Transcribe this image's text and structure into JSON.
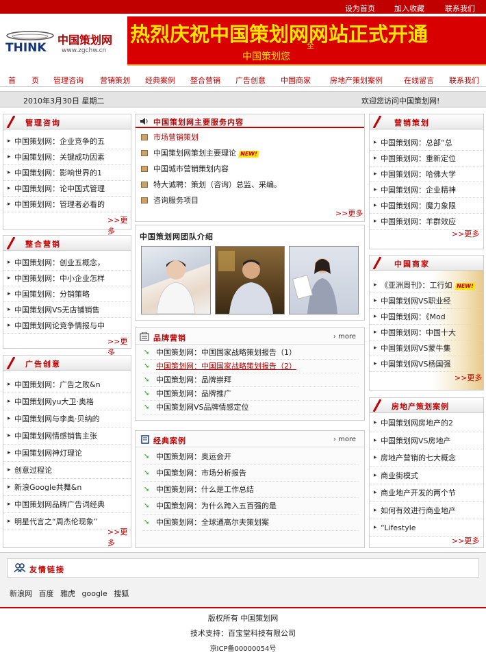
{
  "topbar": {
    "home": "设为首页",
    "fav": "加入收藏",
    "contact": "联系我们"
  },
  "logo": {
    "brand": "THINK",
    "name": "中国策划网",
    "url": "www.zgchw.cn"
  },
  "banner": {
    "title": "热烈庆祝中国策划网网站正式开通",
    "subtitle": "中国策划您",
    "star": "全"
  },
  "nav": [
    "首",
    "页",
    "管理咨询",
    "营销策划",
    "经典案例",
    "整合营销",
    "广告创意",
    "中国商家",
    "房地产策划案例",
    "在线留言",
    "联系我们"
  ],
  "datebar": {
    "date": "2010年3月30日 星期二",
    "welcome": "欢迎您访问中国策划网!"
  },
  "left": {
    "guanli": {
      "title": "管理咨询",
      "items": [
        "中国策划网：企业竞争的五",
        "中国策划网：关键成功因素",
        "中国策划网：影响世界的1",
        "中国策划网：论中国式管理",
        "中国策划网：管理者必看的"
      ],
      "more": ">>更多"
    },
    "zhenghe": {
      "title": "整合营销",
      "items": [
        "中国策划网：创业五概念，",
        "中国策划网：中小企业怎样",
        "中国策划网：分销策略",
        "中国策划网VS无店铺销售",
        "中国策划网论竞争情报与中"
      ],
      "more": ">>更多"
    },
    "guanggao": {
      "title": "广告创意",
      "items": [
        "中国策划网：广告之败&n",
        "中国策划网yu大卫·奥格",
        "中国策划网与李奥·贝纳的",
        "中国策划网情感销售主张",
        "中国策划网神灯理论",
        "创意过程论",
        "新浪Google共舞&n",
        "中国策划网品牌广告词经典",
        "明星代言之“周杰伦现象”"
      ],
      "more": ">>更多"
    }
  },
  "center": {
    "services": {
      "title": "中国策划网主要服务内容",
      "items": [
        "市场营销策划",
        "中国策划网策划主要理论",
        "中国城市营销策划内容",
        "特大诚聘：策划（咨询）总监、采编。",
        "咨询服务项目"
      ],
      "new": "NEW!",
      "more": ">>更多"
    },
    "team": {
      "title": "中国策划网团队介绍"
    },
    "brand": {
      "title": "品牌营销",
      "more": "more",
      "items": [
        "中国策划网：中国国家战略策划报告（1）",
        "中国策划网：中国国家战略策划报告（2）",
        "中国策划网：品牌崇拜",
        "中国策划网：品牌推广",
        "中国策划网VS品牌情感定位"
      ]
    },
    "classic": {
      "title": "经典案例",
      "more": "more",
      "items": [
        "中国策划网：奥运会开",
        "中国策划网：市场分析报告",
        "中国策划网：什么是工作总结",
        "中国策划网：为什么跨入五百强的是",
        "中国策划网：全球通高尔夫策划案"
      ]
    }
  },
  "right": {
    "yingxiao": {
      "title": "营销策划",
      "items": [
        "中国策划网：总部“总",
        "中国策划网：重新定位",
        "中国策划网：哈佛大学",
        "中国策划网：企业精神",
        "中国策划网：魔力象限",
        "中国策划网：羊群效应"
      ],
      "more": ">>更多"
    },
    "shangjia": {
      "title": "中国商家",
      "items": [
        "《亚洲周刊》：工行如",
        "中国策划网VS职业经",
        "中国策划网：《Mod",
        "中国策划网：中国十大",
        "中国策划网VS蒙牛集",
        "中国策划网VS杨国强"
      ],
      "new": "NEW!",
      "more": ">>更多"
    },
    "fangdichan": {
      "title": "房地产策划案例",
      "items": [
        "中国策划网房地产的2",
        "中国策划网VS房地产",
        "房地产营销的七大概念",
        "商业街模式",
        "商业地产开发的两个节",
        "如何有效进行商业地产",
        "“Lifestyle"
      ],
      "more": ">>更多"
    }
  },
  "friend": {
    "title": "友情链接",
    "links": [
      "新浪网",
      "百度",
      "雅虎",
      "google",
      "搜狐"
    ]
  },
  "footer": {
    "copyright": "版权所有  中国策划网",
    "support": "技术支持：百宝堂科技有限公司",
    "icp": "京ICP备00000054号"
  },
  "colors": {
    "brand_red": "#c00000",
    "banner_red": "#d80000",
    "banner_text": "#ffe400"
  }
}
